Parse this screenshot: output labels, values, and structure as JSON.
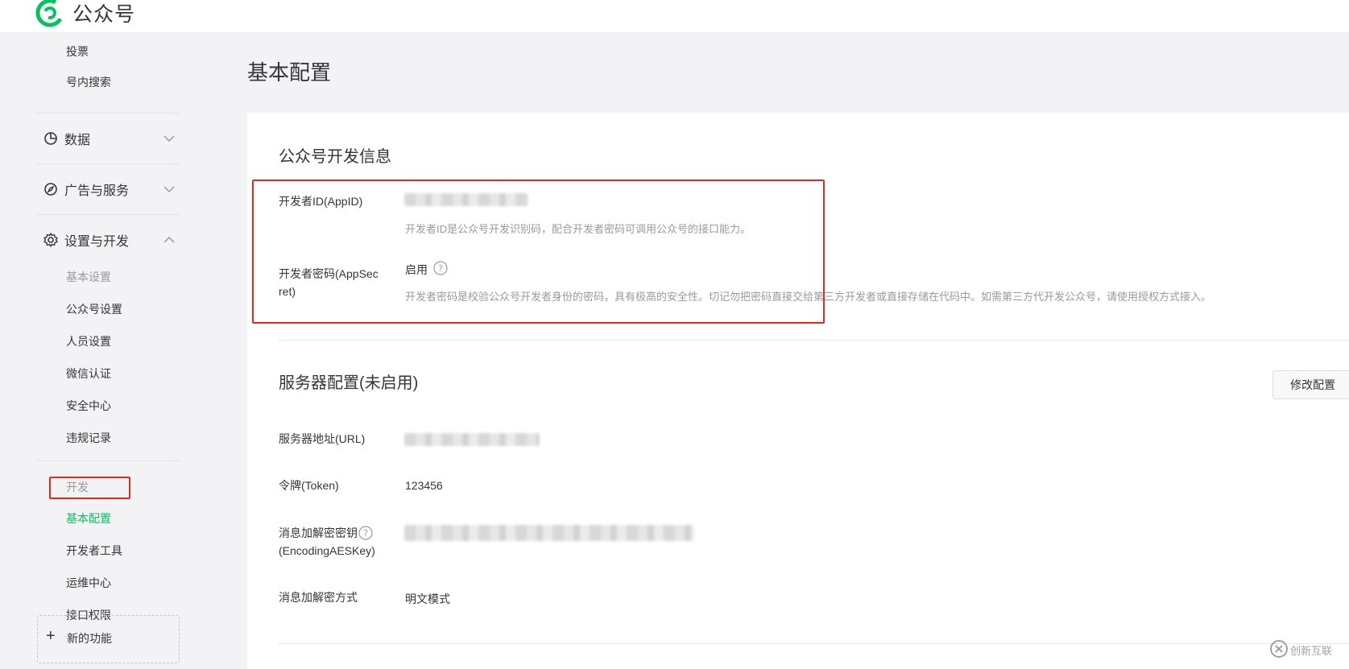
{
  "app": {
    "title": "公众号"
  },
  "sidebar": {
    "items_top": [
      {
        "label": "投票"
      },
      {
        "label": "号内搜索"
      }
    ],
    "groups": {
      "data": {
        "label": "数据"
      },
      "ads": {
        "label": "广告与服务"
      },
      "settings": {
        "label": "设置与开发"
      }
    },
    "settings_items": [
      {
        "label": "基本设置"
      },
      {
        "label": "公众号设置"
      },
      {
        "label": "人员设置"
      },
      {
        "label": "微信认证"
      },
      {
        "label": "安全中心"
      },
      {
        "label": "违规记录"
      }
    ],
    "dev_header": "开发",
    "dev_items": [
      {
        "label": "基本配置"
      },
      {
        "label": "开发者工具"
      },
      {
        "label": "运维中心"
      },
      {
        "label": "接口权限"
      }
    ],
    "new_feature": "新的功能"
  },
  "main": {
    "page_title": "基本配置",
    "dev_info": {
      "title": "公众号开发信息",
      "appid_label": "开发者ID(AppID)",
      "appid_desc": "开发者ID是公众号开发识别码，配合开发者密码可调用公众号的接口能力。",
      "secret_label_1": "开发者密码(AppSec",
      "secret_label_2": "ret)",
      "secret_status": "启用",
      "secret_desc": "开发者密码是校验公众号开发者身份的密码，具有极高的安全性。切记勿把密码直接交给第三方开发者或直接存储在代码中。如需第三方代开发公众号，请使用授权方式接入。"
    },
    "server": {
      "title": "服务器配置(未启用)",
      "modify_button": "修改配置",
      "url_label": "服务器地址(URL)",
      "token_label": "令牌(Token)",
      "token_value": "123456",
      "aes_label_1": "消息加解密密钥",
      "aes_label_2": "(EncodingAESKey)",
      "mode_label": "消息加解密方式",
      "mode_value": "明文模式"
    }
  },
  "watermark": {
    "text": "创新互联"
  },
  "colors": {
    "accent": "#07c160",
    "highlight_box": "#e0281c"
  }
}
